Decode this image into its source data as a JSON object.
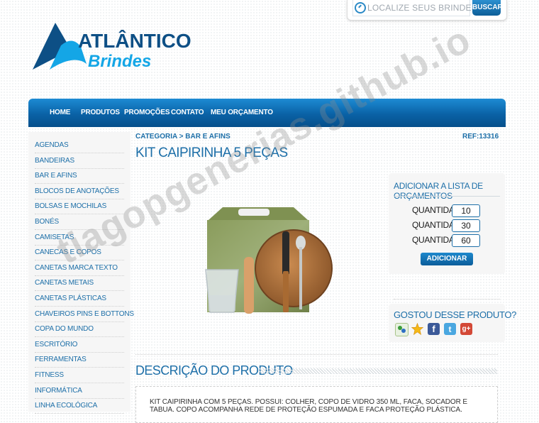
{
  "search": {
    "placeholder": "LOCALIZE SEUS BRINDES!",
    "button_label": "BUSCAR"
  },
  "logo": {
    "line1": "ATLÂNTICO",
    "line2": "Brindes",
    "color_dark": "#0d4f85",
    "color_light": "#14a6e6"
  },
  "nav": {
    "items": [
      "HOME",
      "PRODUTOS",
      "PROMOÇÕES",
      "CONTATO",
      "MEU ORÇAMENTO"
    ]
  },
  "sidebar": {
    "items": [
      "AGENDAS",
      "BANDEIRAS",
      "BAR E AFINS",
      "BLOCOS DE ANOTAÇÕES",
      "BOLSAS E MOCHILAS",
      "BONÉS",
      "CAMISETAS",
      "CANECAS E COPOS",
      "CANETAS MARCA TEXTO",
      "CANETAS METAIS",
      "CANETAS PLÁSTICAS",
      "CHAVEIROS PINS E BOTTONS",
      "COPA DO MUNDO",
      "ESCRITÓRIO",
      "FERRAMENTAS",
      "FITNESS",
      "INFORMÁTICA",
      "LINHA ECOLÓGICA"
    ]
  },
  "breadcrumb": {
    "text": "CATEGORIA > BAR E AFINS"
  },
  "product": {
    "ref": "REF:13316",
    "title": "KIT CAIPIRINHA 5 PEÇAS"
  },
  "add_list": {
    "title": "ADICIONAR A LISTA DE ORÇAMENTOS",
    "quantity_label": "QUANTIDADE:",
    "quantities": [
      "10",
      "30",
      "60"
    ],
    "button_label": "ADICIONAR"
  },
  "share": {
    "title": "GOSTOU DESSE PRODUTO?",
    "icons": [
      "messenger-icon",
      "favorite-star-icon",
      "facebook-icon",
      "twitter-icon",
      "google-plus-icon"
    ]
  },
  "description": {
    "title": "DESCRIÇÃO DO PRODUTO",
    "text": "KIT CAIPIRINHA COM 5 PEÇAS. POSSUI: COLHER, COPO DE VIDRO 350 ML, FACA, SOCADOR E TABUA. COPO ACOMPANHA REDE DE PROTEÇÃO ESPUMADA E FACA PROTEÇÃO PLÁSTICA."
  },
  "watermark": "tiagopgenerias.github.io",
  "colors": {
    "accent": "#1d6fa8",
    "nav_top": "#1d8bd3",
    "nav_bottom": "#054f8b"
  }
}
